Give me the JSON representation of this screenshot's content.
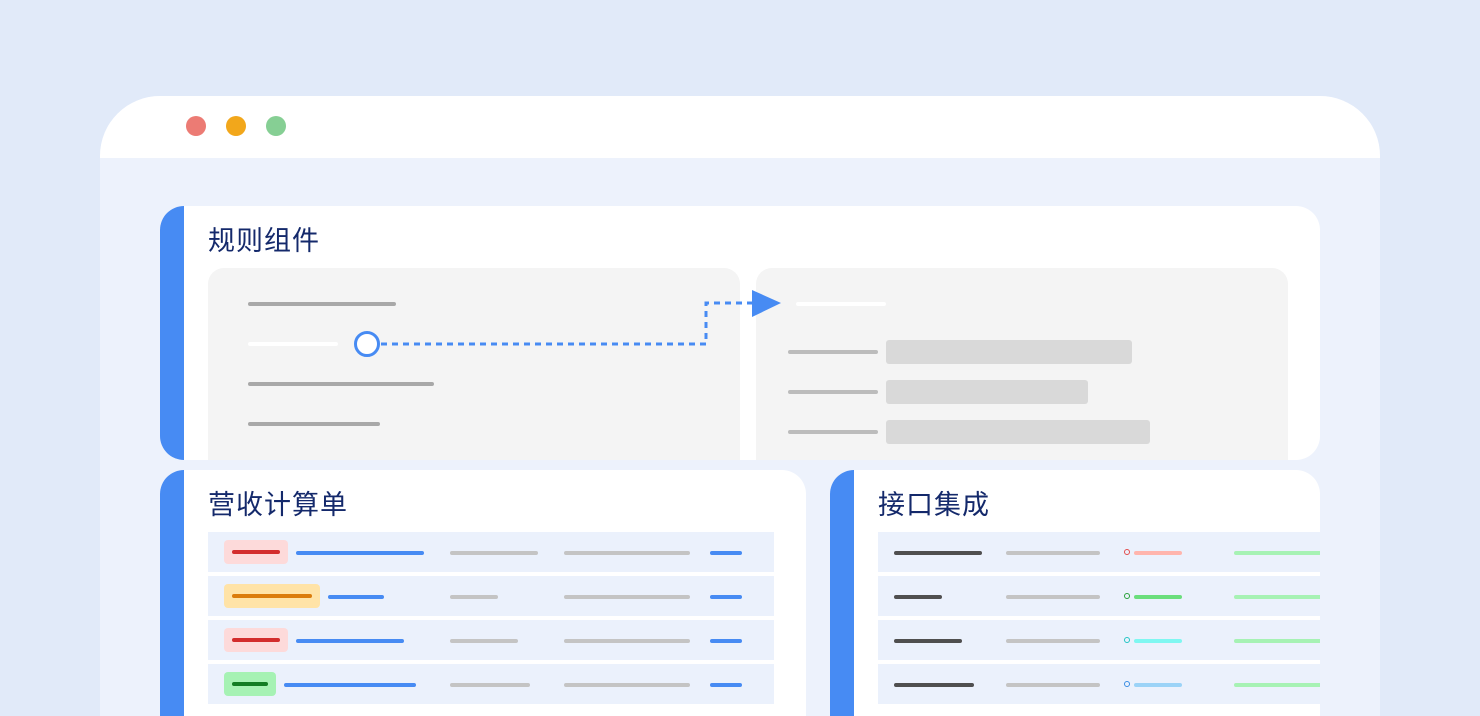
{
  "window": {
    "controls": [
      {
        "name": "close",
        "color": "#ec7b74"
      },
      {
        "name": "minimize",
        "color": "#f2a71b"
      },
      {
        "name": "maximize",
        "color": "#86cf94"
      }
    ]
  },
  "accent_color": "#478bf3",
  "rules_card": {
    "title": "规则组件",
    "left_chips": [
      "#ffe5a9",
      "#ffbcae",
      "#ebd5f6",
      "#d5f8d7"
    ],
    "connector_color": "#478bf3",
    "right_target_chip": "#ffbcae"
  },
  "revenue_card": {
    "title": "营收计算单",
    "status_tags": [
      {
        "bg": "#fddada",
        "line": "#d32d2d"
      },
      {
        "bg": "#ffe3a7",
        "line": "#db7c0b"
      },
      {
        "bg": "#fddada",
        "line": "#d32d2d"
      },
      {
        "bg": "#a6f2b4",
        "line": "#127d23"
      }
    ]
  },
  "api_card": {
    "title": "接口集成",
    "status_dots": [
      {
        "ring": "#e24c4c",
        "line": "#ffb5ad"
      },
      {
        "ring": "#28a038",
        "line": "#6ade7c"
      },
      {
        "ring": "#23c4c4",
        "line": "#7ff7f1"
      },
      {
        "ring": "#3a8de3",
        "line": "#9bd3f7"
      }
    ]
  }
}
